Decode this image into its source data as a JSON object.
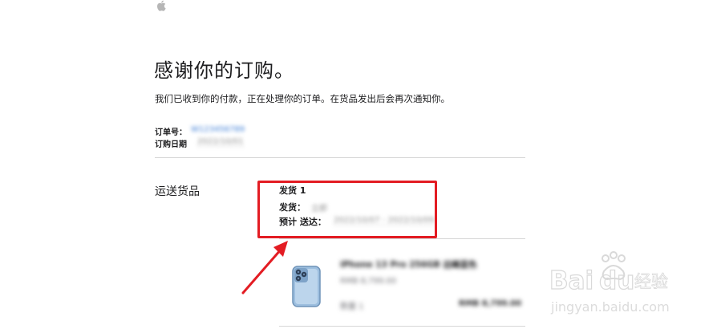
{
  "header": {
    "logo_icon": "apple-logo-icon"
  },
  "main": {
    "title": "感谢你的订购。",
    "subtitle": "我们已收到你的付款，正在处理你的订单。在货品发出后会再次通知你。",
    "order": {
      "number_label": "订单号：",
      "number_value": "W123456789",
      "date_label": "订购日期",
      "date_value": "2022/10/01"
    },
    "shipping": {
      "heading": "运送货品",
      "shipment_title": "发货 1",
      "ship_label": "发货：",
      "ship_value": "立即",
      "eta_label": "预计 送达：",
      "eta_value": "2022/10/07 - 2022/10/09"
    },
    "product": {
      "name": "iPhone 13 Pro 256GB 远峰蓝色",
      "unit_price": "RMB 8,799.00",
      "qty": "数量 1",
      "total": "RMB 8,799.00"
    }
  },
  "watermark": {
    "brand": "Bai",
    "brand2": "du",
    "suffix": "经验",
    "url": "jingyan.baidu.com"
  },
  "colors": {
    "highlight_box": "#e31c23",
    "arrow": "#e31c23",
    "link": "#3a7bd5",
    "phone": "#8fb4d8"
  }
}
